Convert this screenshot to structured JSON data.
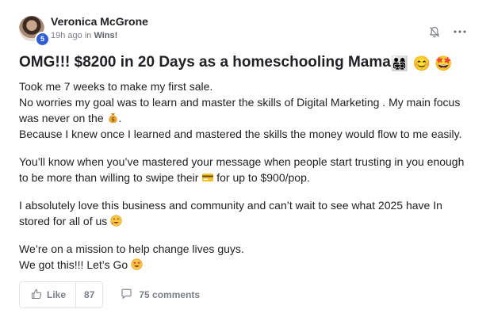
{
  "post": {
    "author": "Veronica McGrone",
    "level": "5",
    "time_ago": "19h ago in",
    "category": "Wins!",
    "title_text": "OMG!!! $8200 in 20 Days as a homeschooling Mama",
    "title_emojis": [
      "👨‍👩‍👧‍👦",
      "😊",
      "🤩"
    ],
    "paragraphs": {
      "p1_line1": "Took me 7 weeks to make my first sale.",
      "p1_line2": "No worries my goal was to learn and master the skills of Digital Marketing . My main focus was never on the ",
      "p1_line2_end": ".",
      "p1_line3": "Because I knew once I learned and mastered the skills the money would flow to me easily.",
      "p2_start": "You’ll know when you’ve mastered your message when people start trusting in you enough to be more than willing to swipe their ",
      "p2_end": " for up to $900/pop.",
      "p3": "I absolutely love this business and community and can’t wait to see what 2025 have In stored for all of us ",
      "p4_line1": "We’re on a mission to help change lives guys.",
      "p4_line2": "We got this!!! Let’s Go "
    }
  },
  "actions": {
    "like_label": "Like",
    "like_count": "87",
    "comments_label": "75 comments"
  },
  "icons": {
    "bell": "bell-icon",
    "more": "more-options-icon",
    "thumbs_up": "thumbs-up-icon",
    "comment": "comment-icon",
    "money_bag": "money-bag-icon",
    "credit_card": "credit-card-icon",
    "smiling_face": "smiling-face-icon",
    "star_struck": "star-struck-icon"
  },
  "colors": {
    "text": "#202124",
    "muted": "#7b7f85",
    "badge": "#2f5bd3",
    "border": "#e3e4e6"
  }
}
